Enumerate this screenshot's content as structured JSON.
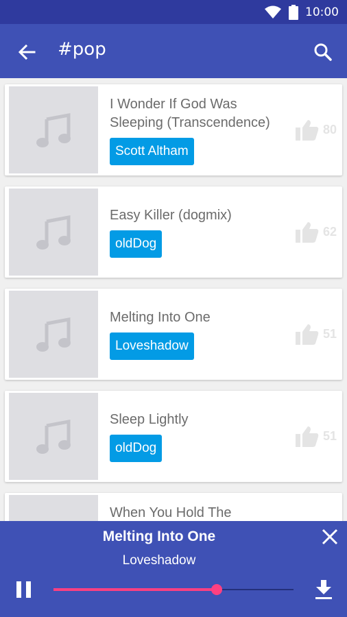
{
  "status_bar": {
    "time": "10:00"
  },
  "app_bar": {
    "title": "#pop",
    "back_icon": "arrow-back-icon",
    "search_icon": "search-icon"
  },
  "tracks": [
    {
      "title": "I Wonder If God Was Sleeping (Transcendence)",
      "artist": "Scott Altham",
      "likes": "80"
    },
    {
      "title": "Easy Killer (dogmix)",
      "artist": "oldDog",
      "likes": "62"
    },
    {
      "title": "Melting Into One",
      "artist": "Loveshadow",
      "likes": "51"
    },
    {
      "title": "Sleep Lightly",
      "artist": "oldDog",
      "likes": "51"
    },
    {
      "title": "When You Hold The",
      "artist": "",
      "likes": ""
    }
  ],
  "player": {
    "title": "Melting Into One",
    "artist": "Loveshadow",
    "progress": 0.68,
    "accent_color": "#ff4081"
  },
  "colors": {
    "primary": "#3f51b5",
    "status_bar": "#2f3a9e",
    "chip": "#039be5"
  }
}
